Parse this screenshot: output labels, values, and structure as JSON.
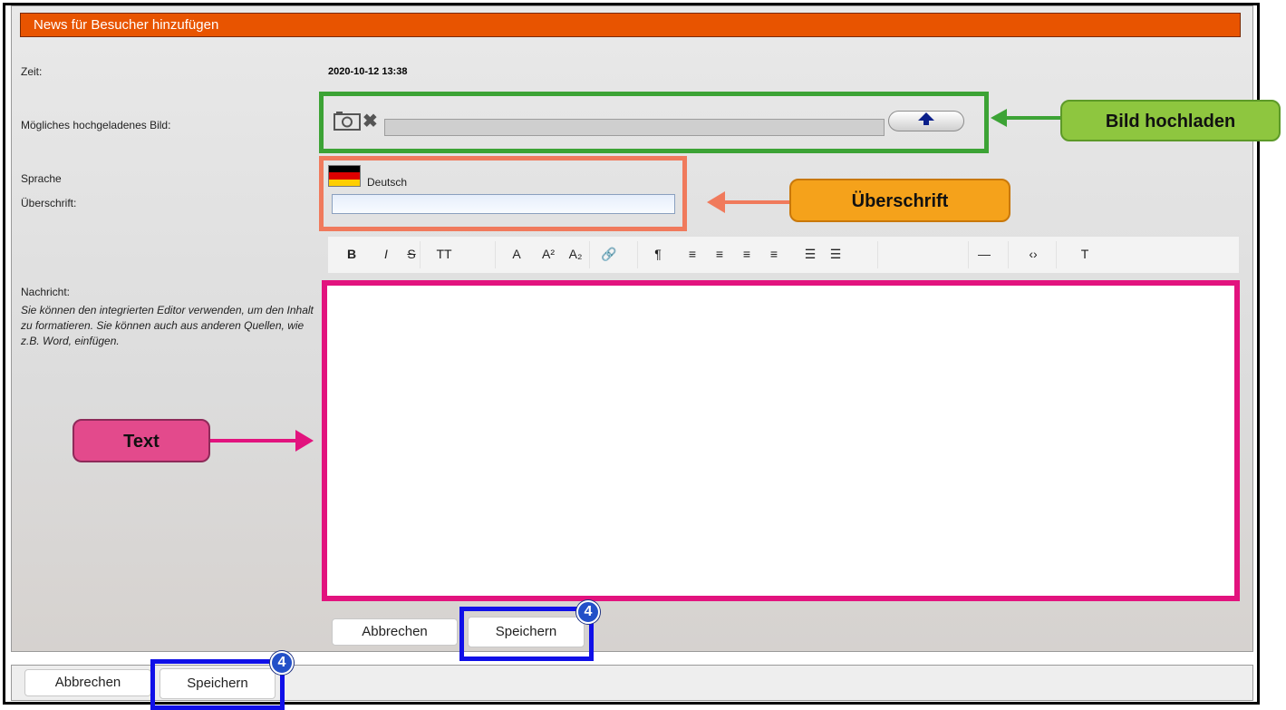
{
  "window": {
    "title": "News für Besucher hinzufügen"
  },
  "form": {
    "time_label": "Zeit:",
    "time_value": "2020-10-12 13:38",
    "image_label": "Mögliches hochgeladenes Bild:",
    "language_label": "Sprache",
    "language_value": "Deutsch",
    "heading_label": "Überschrift:",
    "heading_value": "",
    "message_label": "Nachricht:",
    "message_hint": "Sie können den integrierten Editor verwenden, um den Inhalt zu formatieren. Sie können auch aus anderen Quellen, wie z.B. Word, einfügen.",
    "message_value": ""
  },
  "toolbar": {
    "items": [
      {
        "icon": "bold-icon",
        "glyph": "B"
      },
      {
        "icon": "italic-icon",
        "glyph": "I"
      },
      {
        "icon": "strikethrough-icon",
        "glyph": "S"
      },
      {
        "icon": "font-size-icon",
        "glyph": "TT"
      },
      {
        "icon": "text-color-icon",
        "glyph": "A"
      },
      {
        "icon": "superscript-icon",
        "glyph": "A²"
      },
      {
        "icon": "subscript-icon",
        "glyph": "A₂"
      },
      {
        "icon": "link-icon",
        "glyph": "🔗"
      },
      {
        "icon": "paragraph-icon",
        "glyph": "¶"
      },
      {
        "icon": "align-left-icon",
        "glyph": "≡"
      },
      {
        "icon": "align-center-icon",
        "glyph": "≡"
      },
      {
        "icon": "align-right-icon",
        "glyph": "≡"
      },
      {
        "icon": "align-justify-icon",
        "glyph": "≡"
      },
      {
        "icon": "bullet-list-icon",
        "glyph": "☰"
      },
      {
        "icon": "numbered-list-icon",
        "glyph": "☰"
      },
      {
        "icon": "horizontal-rule-icon",
        "glyph": "—"
      },
      {
        "icon": "code-icon",
        "glyph": "‹›"
      },
      {
        "icon": "clear-format-icon",
        "glyph": "T"
      }
    ]
  },
  "buttons": {
    "cancel_inner": "Abbrechen",
    "save_inner": "Speichern",
    "cancel_footer": "Abbrechen",
    "save_footer": "Speichern"
  },
  "annotations": {
    "upload_callout": "Bild hochladen",
    "heading_callout": "Überschrift",
    "text_callout": "Text",
    "step_badge": "4"
  },
  "colors": {
    "titlebar": "#e85400",
    "upload_box": "#3ca335",
    "heading_box": "#f07a5c",
    "text_box": "#e2137e",
    "save_box": "#1010e8"
  }
}
